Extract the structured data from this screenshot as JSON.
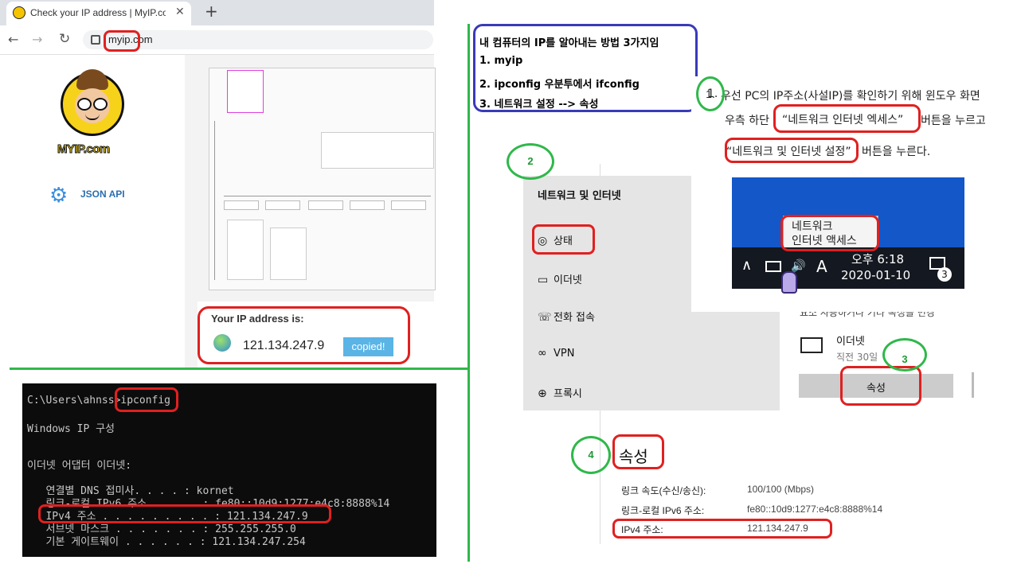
{
  "browser": {
    "tab_title": "Check your IP address | MyIP.co",
    "new_tab": "+",
    "url": "myip.com",
    "logo_text": "MYIP.com",
    "json_api_label": "JSON API",
    "ip_label": "Your IP address is:",
    "ip_value": "121.134.247.9",
    "copied_label": "copied!"
  },
  "notes": {
    "line1": "내 컴퓨터의 IP를 알아내는 방법 3가지임",
    "line2": "1. myip",
    "line3": "2. ipconfig 우분투에서 ifconfig",
    "line4": "3. 네트워크 설정 --> 속성"
  },
  "cmd": {
    "prompt": "C:\\Users\\ahnss>ipconfig",
    "header": "Windows IP 구성",
    "adapter": "이더넷 어댑터 이더넷:",
    "dns": "   연결별 DNS 접미사. . . . : kornet",
    "ipv6": "   링크-로컬 IPv6 주소 . . . . : fe80::10d9:1277:e4c8:8888%14",
    "ipv4": "   IPv4 주소 . . . . . . . . . : 121.134.247.9",
    "subnet": "   서브넷 마스크 . . . . . . . : 255.255.255.0",
    "gateway": "   기본 게이트웨이 . . . . . . : 121.134.247.254"
  },
  "instructions": {
    "step1_num": "1.",
    "step1_a": "우선 PC의 IP주소(사설IP)를 확인하기 위해 윈도우 화면",
    "step1_b": "우측 하단",
    "step1_c": "“네트워크 인터넷 엑세스”",
    "step1_d": "버튼을 누르고",
    "step1_e": "“네트워크 및 인터넷 설정”",
    "step1_f": "버튼을 누른다."
  },
  "taskbar": {
    "tooltip_line1": "네트워크",
    "tooltip_line2": "인터넷 액세스",
    "time": "오후 6:18",
    "date": "2020-01-10",
    "ime": "A",
    "notif_count": "3"
  },
  "settings": {
    "title": "네트워크 및 인터넷",
    "items": [
      {
        "label": "상태",
        "icon": "status-icon"
      },
      {
        "label": "이더넷",
        "icon": "ethernet-icon"
      },
      {
        "label": "전화 접속",
        "icon": "dialup-icon"
      },
      {
        "label": "VPN",
        "icon": "vpn-icon"
      },
      {
        "label": "프록시",
        "icon": "globe-icon"
      }
    ],
    "partial_text": "요소 사용하거나 기타 속성을 변경",
    "ethernet_name": "이더넷",
    "ethernet_time": "직전 30일",
    "properties_button": "속성"
  },
  "properties": {
    "title": "속성",
    "rows": [
      {
        "label": "링크 속도(수신/송신):",
        "value": "100/100 (Mbps)"
      },
      {
        "label": "링크-로컬 IPv6 주소:",
        "value": "fe80::10d9:1277:e4c8:8888%14"
      },
      {
        "label": "IPv4 주소:",
        "value": "121.134.247.9"
      }
    ]
  },
  "markers": {
    "m1": "1.",
    "m2": "2",
    "m3": "3",
    "m4": "4"
  },
  "colors": {
    "red": "#e02020",
    "green": "#2fb84a",
    "blue": "#3a3ab8",
    "taskbar_blue": "#1357c9"
  }
}
